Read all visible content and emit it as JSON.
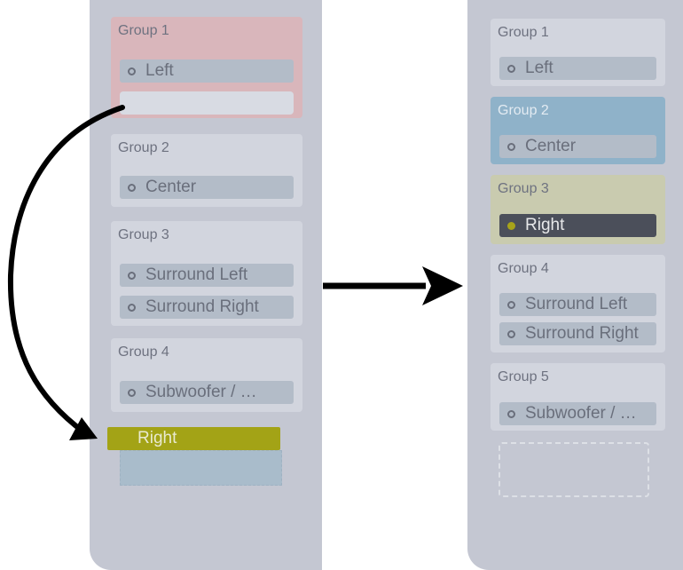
{
  "before": {
    "groups": [
      {
        "title": "Group 1",
        "channels": [
          "Left"
        ]
      },
      {
        "title": "Group 2",
        "channels": [
          "Center"
        ]
      },
      {
        "title": "Group 3",
        "channels": [
          "Surround Left",
          "Surround Right"
        ]
      },
      {
        "title": "Group 4",
        "channels": [
          "Subwoofer / …"
        ]
      }
    ],
    "dragged_channel": "Right"
  },
  "after": {
    "groups": [
      {
        "title": "Group 1",
        "channels": [
          "Left"
        ]
      },
      {
        "title": "Group 2",
        "channels": [
          "Center"
        ]
      },
      {
        "title": "Group 3",
        "channels": [
          "Right"
        ]
      },
      {
        "title": "Group 4",
        "channels": [
          "Surround Left",
          "Surround Right"
        ]
      },
      {
        "title": "Group 5",
        "channels": [
          "Subwoofer / …"
        ]
      }
    ]
  },
  "colors": {
    "panel": "#c4c7d2",
    "group": "#d2d5de",
    "highlight_red": "#d9b6bb",
    "highlight_blue": "#8fb2c9",
    "highlight_yellow": "#c9cbaf",
    "drag_chip": "#a3a316",
    "arrow": "#000000"
  }
}
